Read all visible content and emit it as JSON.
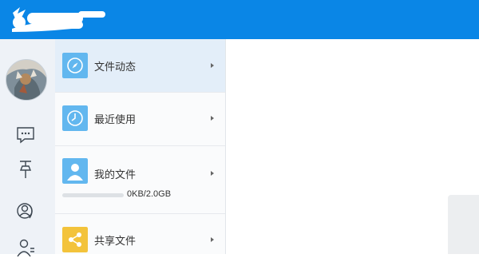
{
  "colors": {
    "topbar": "#0a86e6",
    "icon_blue": "#62b7ef",
    "icon_yellow": "#f3c33b",
    "active_row": "#e3eef9"
  },
  "icons": {
    "logo": "bird-logo-icon",
    "rail": [
      "chat-icon",
      "pin-icon",
      "contacts-circle-icon",
      "user-icon"
    ]
  },
  "menu": {
    "items": [
      {
        "label": "文件动态",
        "icon": "compass-icon",
        "active": true
      },
      {
        "label": "最近使用",
        "icon": "clock-icon",
        "active": false
      },
      {
        "label": "我的文件",
        "icon": "user-file-icon",
        "active": false
      },
      {
        "label": "共享文件",
        "icon": "share-icon",
        "active": false
      }
    ],
    "storage": {
      "text": "0KB/2.0GB",
      "used_fraction": 0.0
    }
  }
}
